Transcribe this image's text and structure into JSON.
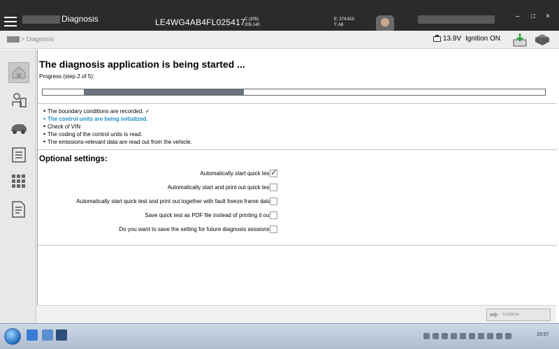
{
  "header": {
    "app_title": "Diagnosis",
    "vin": "LE4WG4AB4FL025417",
    "c_label": "C (205)",
    "c_value": "205.140",
    "e_label": "E: 274.910",
    "t_label": "T: A8",
    "window_controls": {
      "minimize": "–",
      "restore": "□",
      "close": "×"
    }
  },
  "status": {
    "breadcrumb": "> Diagnosis",
    "voltage": "13.9V",
    "ignition": "Ignition ON"
  },
  "main": {
    "title": "The diagnosis application is being started ...",
    "progress_label": "Progress (step 2 of 5):",
    "progress_fraction": 0.4,
    "steps": [
      "The boundary conditions are recorded. ✓",
      "The control units are being initialized.",
      "Check of VIN",
      "The coding of the control units is read.",
      "The emissions-relevant data are read out from the vehicle."
    ],
    "current_step_index": 1,
    "optional_title": "Optional settings:",
    "options": [
      {
        "label": "Automatically start quick test.",
        "checked": true
      },
      {
        "label": "Automatically start and print out quick test.",
        "checked": false
      },
      {
        "label": "Automatically start quick test and print out together with fault freeze frame data.",
        "checked": false
      },
      {
        "label": "Save quick test as PDF file instead of printing it out.",
        "checked": false
      },
      {
        "label": "Do you want to save the setting for future diagnosis sessions?",
        "checked": false
      }
    ]
  },
  "footer": {
    "continue_label": "Continue"
  },
  "taskbar": {
    "clock": "15:57"
  },
  "icons": {
    "sidebar": [
      "home-icon",
      "technician-icon",
      "vehicle-icon",
      "list-icon",
      "grid-icon",
      "document-icon"
    ]
  },
  "colors": {
    "current_step": "#1a8fc7",
    "progress_fill": "#6b7280",
    "topbar": "#2b2b2b"
  }
}
